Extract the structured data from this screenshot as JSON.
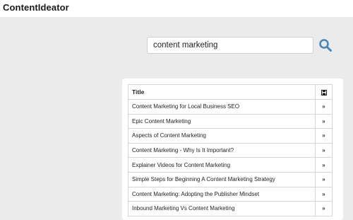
{
  "app": {
    "title": "ContentIdeator"
  },
  "search": {
    "value": "content marketing",
    "icon": "search-icon",
    "accent_color": "#4a86b8"
  },
  "table": {
    "header": {
      "title": "Title",
      "action_icon": "save-icon"
    },
    "rows": [
      {
        "title": "Content Marketing for Local Business SEO",
        "action": "»"
      },
      {
        "title": "Epic Content Marketing",
        "action": "»"
      },
      {
        "title": "Aspects of Content Marketing",
        "action": "»"
      },
      {
        "title": "Content Marketing - Why Is It Important?",
        "action": "»"
      },
      {
        "title": "Explainer Videos for Content Marketing",
        "action": "»"
      },
      {
        "title": "Simple Steps for Beginning A Content Marketing Strategy",
        "action": "»"
      },
      {
        "title": "Content Marketing: Adopting the Publisher Mindset",
        "action": "»"
      },
      {
        "title": "Inbound Marketing Vs Content Marketing",
        "action": "»"
      }
    ]
  }
}
